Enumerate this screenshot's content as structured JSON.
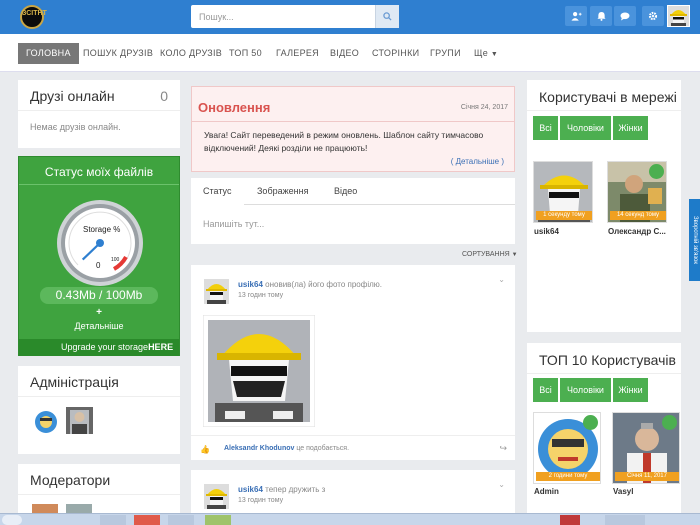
{
  "header": {
    "logo_text": "ЗСІТНТ",
    "search_placeholder": "Пошук...",
    "colors": {
      "bar": "#2f7fd0",
      "accent_green": "#4caf50",
      "orange": "#f0a020"
    }
  },
  "nav": {
    "items": [
      "ГОЛОВНА",
      "ПОШУК ДРУЗІВ",
      "КОЛО ДРУЗІВ",
      "ТОП 50",
      "ГАЛЕРЕЯ",
      "ВІДЕО",
      "СТОРІНКИ",
      "ГРУПИ",
      "Ще"
    ]
  },
  "friends_online": {
    "title": "Друзі онлайн",
    "count": "0",
    "empty": "Немає друзів онлайн."
  },
  "storage": {
    "title": "Статус моїх файлів",
    "gauge_label": "Storage %",
    "gauge_zero": "0",
    "gauge_max": "100",
    "usage": "0.43Mb / 100Mb",
    "details": "Детальніше",
    "upgrade": "Upgrade your storage",
    "upgrade_here": "HERE",
    "percent": 0.43
  },
  "admins": {
    "title": "Адміністрація"
  },
  "moderators": {
    "title": "Модератори"
  },
  "update": {
    "title": "Оновлення",
    "date": "Січня 24, 2017",
    "text": "Увага! Сайт переведений в режим оновлень. Шаблон сайту тимчасово відключений! Деякі розділи не працюють!",
    "details": "( Детальніше )"
  },
  "composer": {
    "tabs": [
      "Статус",
      "Зображення",
      "Відео"
    ],
    "placeholder": "Напишіть тут..."
  },
  "sort_label": "СОРТУВАННЯ",
  "feed": [
    {
      "user": "usik64",
      "action": "оновив(ла) його фото профілю.",
      "time": "13 годин тому",
      "liker": "Aleksandr Khodunov",
      "like_text": "це подобається."
    },
    {
      "user": "usik64",
      "action": "тепер дружить з",
      "time": "13 годин тому"
    }
  ],
  "online_users": {
    "title": "Користувачі в мережі",
    "filters": [
      "Всі",
      "Чоловіки",
      "Жінки"
    ],
    "users": [
      {
        "name": "usik64",
        "badge": "1 секунду тому"
      },
      {
        "name": "Олександр С...",
        "badge": "14 секунд тому"
      }
    ]
  },
  "top10": {
    "title": "ТОП 10 Користувачів",
    "filters": [
      "Всі",
      "Чоловіки",
      "Жінки"
    ],
    "users": [
      {
        "name": "Admin",
        "badge": "2 години тому"
      },
      {
        "name": "Vasyl",
        "badge": "Січня 11, 2017"
      }
    ]
  },
  "side_tab": "Зворотній зв'язок"
}
